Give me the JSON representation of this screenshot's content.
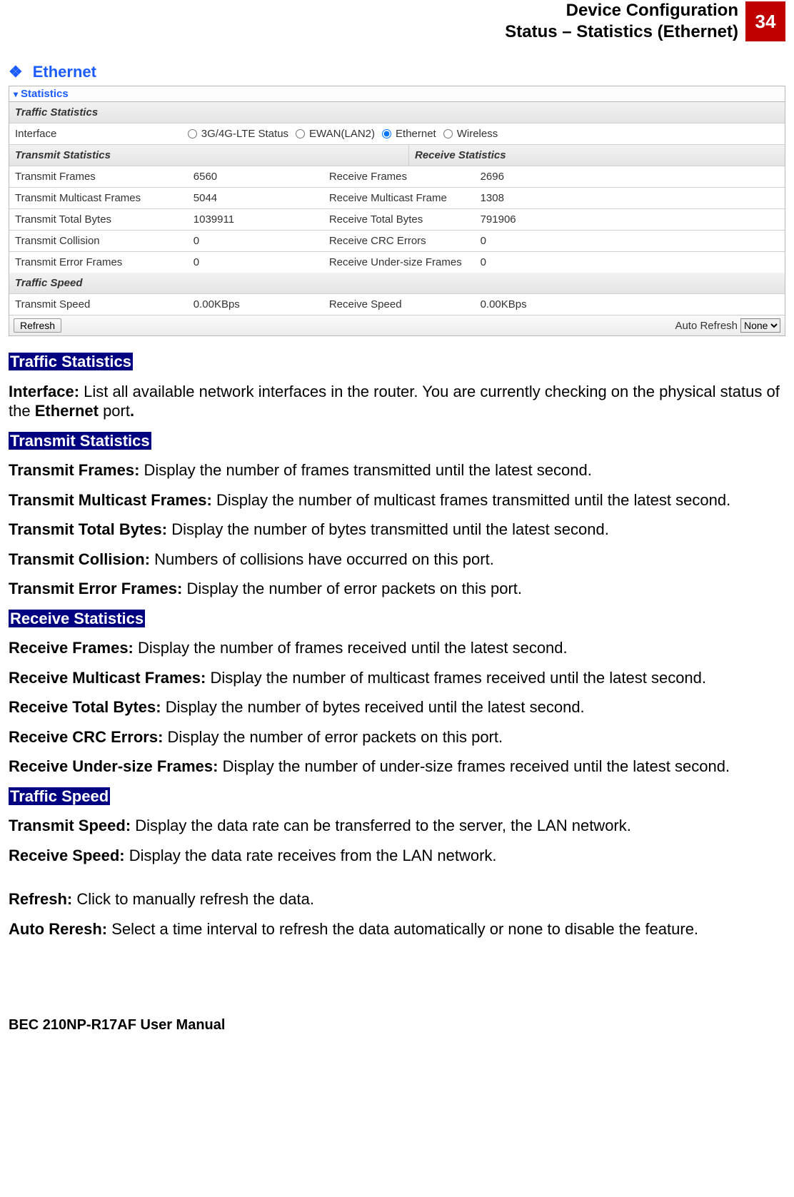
{
  "header": {
    "line1": "Device Configuration",
    "line2": "Status – Statistics (Ethernet)",
    "page_number": "34"
  },
  "bullet_heading": "Ethernet",
  "panel": {
    "title": "Statistics",
    "traffic_stats_header": "Traffic Statistics",
    "interface_label": "Interface",
    "interfaces": {
      "opt1": "3G/4G-LTE Status",
      "opt2": "EWAN(LAN2)",
      "opt3": "Ethernet",
      "opt4": "Wireless"
    },
    "tx_header": "Transmit Statistics",
    "rx_header": "Receive Statistics",
    "rows": [
      {
        "tx_label": "Transmit Frames",
        "tx_val": "6560",
        "rx_label": "Receive Frames",
        "rx_val": "2696"
      },
      {
        "tx_label": "Transmit Multicast Frames",
        "tx_val": "5044",
        "rx_label": "Receive Multicast Frame",
        "rx_val": "1308"
      },
      {
        "tx_label": "Transmit Total Bytes",
        "tx_val": "1039911",
        "rx_label": "Receive Total Bytes",
        "rx_val": "791906"
      },
      {
        "tx_label": "Transmit Collision",
        "tx_val": "0",
        "rx_label": "Receive CRC Errors",
        "rx_val": "0"
      },
      {
        "tx_label": "Transmit Error Frames",
        "tx_val": "0",
        "rx_label": "Receive Under-size Frames",
        "rx_val": "0"
      }
    ],
    "speed_header": "Traffic Speed",
    "speed": {
      "tx_label": "Transmit Speed",
      "tx_val": "0.00KBps",
      "rx_label": "Receive Speed",
      "rx_val": "0.00KBps"
    },
    "refresh_btn": "Refresh",
    "auto_refresh_label": "Auto Refresh",
    "auto_refresh_value": "None"
  },
  "doc": {
    "h_traffic": "Traffic Statistics",
    "interface_label": "Interface: ",
    "interface_text_a": "List all available network interfaces in the router.  You are currently checking on the physical status of the ",
    "interface_text_bold": "Ethernet",
    "interface_text_b": " port",
    "interface_text_dot": ".",
    "h_tx": "Transmit Statistics",
    "tx_frames_label": "Transmit Frames: ",
    "tx_frames_text": "Display the number of frames transmitted until the latest second.",
    "tx_mcast_label": "Transmit Multicast Frames: ",
    "tx_mcast_text": "Display the number of multicast frames transmitted until the latest second.",
    "tx_bytes_label": "Transmit Total Bytes: ",
    "tx_bytes_text": "Display the number of bytes transmitted until the latest second.",
    "tx_coll_label": "Transmit Collision: ",
    "tx_coll_text": "Numbers of collisions have occurred on this port.",
    "tx_err_label": "Transmit Error Frames: ",
    "tx_err_text": "Display the number of error packets on this port.",
    "h_rx": "Receive Statistics",
    "rx_frames_label": "Receive Frames: ",
    "rx_frames_text": "Display the number of frames received until the latest second.",
    "rx_mcast_label": "Receive Multicast Frames: ",
    "rx_mcast_text": "Display the number of multicast frames received until the latest second.",
    "rx_bytes_label": "Receive Total Bytes: ",
    "rx_bytes_text": "Display the number of bytes received until the latest second.",
    "rx_crc_label": "Receive CRC Errors: ",
    "rx_crc_text": "Display the number of error packets on this port.",
    "rx_under_label": "Receive Under-size Frames: ",
    "rx_under_text": "Display the number of under-size frames received until the latest second.",
    "h_speed": "Traffic Speed",
    "sp_tx_label": "Transmit Speed: ",
    "sp_tx_text": "Display the data rate can be transferred to the server, the LAN network.",
    "sp_rx_label": "Receive Speed: ",
    "sp_rx_text": "Display the data rate receives from the LAN network.",
    "refresh_label": "Refresh: ",
    "refresh_text": "Click to manually refresh the data.",
    "auto_label": "Auto Reresh: ",
    "auto_text": "Select a time interval to refresh the data automatically or none to disable the feature."
  },
  "footer": "BEC 210NP-R17AF User Manual"
}
